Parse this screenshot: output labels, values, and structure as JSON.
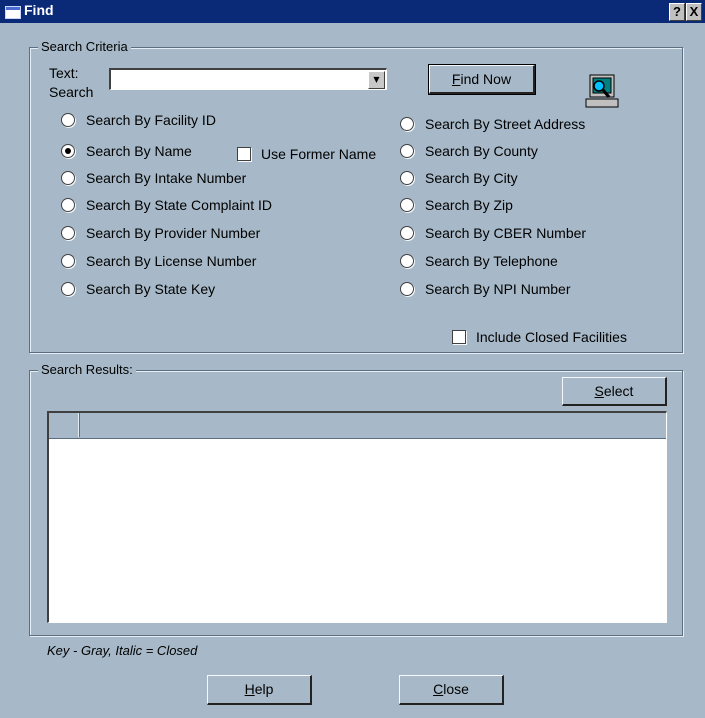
{
  "window": {
    "title": "Find",
    "help_btn": "?",
    "close_btn": "X"
  },
  "criteria": {
    "legend": "Search Criteria",
    "text_label_1": "Text:",
    "text_label_2": "Search",
    "search_value": "",
    "find_now_label": "Find Now",
    "find_now_mnemonic": "F",
    "left_options": [
      {
        "label": "Search By Facility ID",
        "checked": false
      },
      {
        "label": "Search By Name",
        "checked": true
      },
      {
        "label": "Search By Intake Number",
        "checked": false
      },
      {
        "label": "Search By State Complaint ID",
        "checked": false
      },
      {
        "label": "Search By Provider Number",
        "checked": false
      },
      {
        "label": "Search By License Number",
        "checked": false
      },
      {
        "label": "Search By State Key",
        "checked": false
      }
    ],
    "right_options": [
      {
        "label": "Search By Street Address",
        "checked": false
      },
      {
        "label": "Search By County",
        "checked": false
      },
      {
        "label": "Search By City",
        "checked": false
      },
      {
        "label": "Search By Zip",
        "checked": false
      },
      {
        "label": "Search By CBER Number",
        "checked": false
      },
      {
        "label": "Search By Telephone",
        "checked": false
      },
      {
        "label": "Search By NPI Number",
        "checked": false
      }
    ],
    "use_former_name": "Use Former Name",
    "include_closed": "Include Closed Facilities"
  },
  "results": {
    "legend": "Search Results:",
    "select_label": "Select",
    "rows": []
  },
  "footer": {
    "key_text": "Key - Gray, Italic = Closed",
    "help_label": "Help",
    "close_label": "Close"
  }
}
